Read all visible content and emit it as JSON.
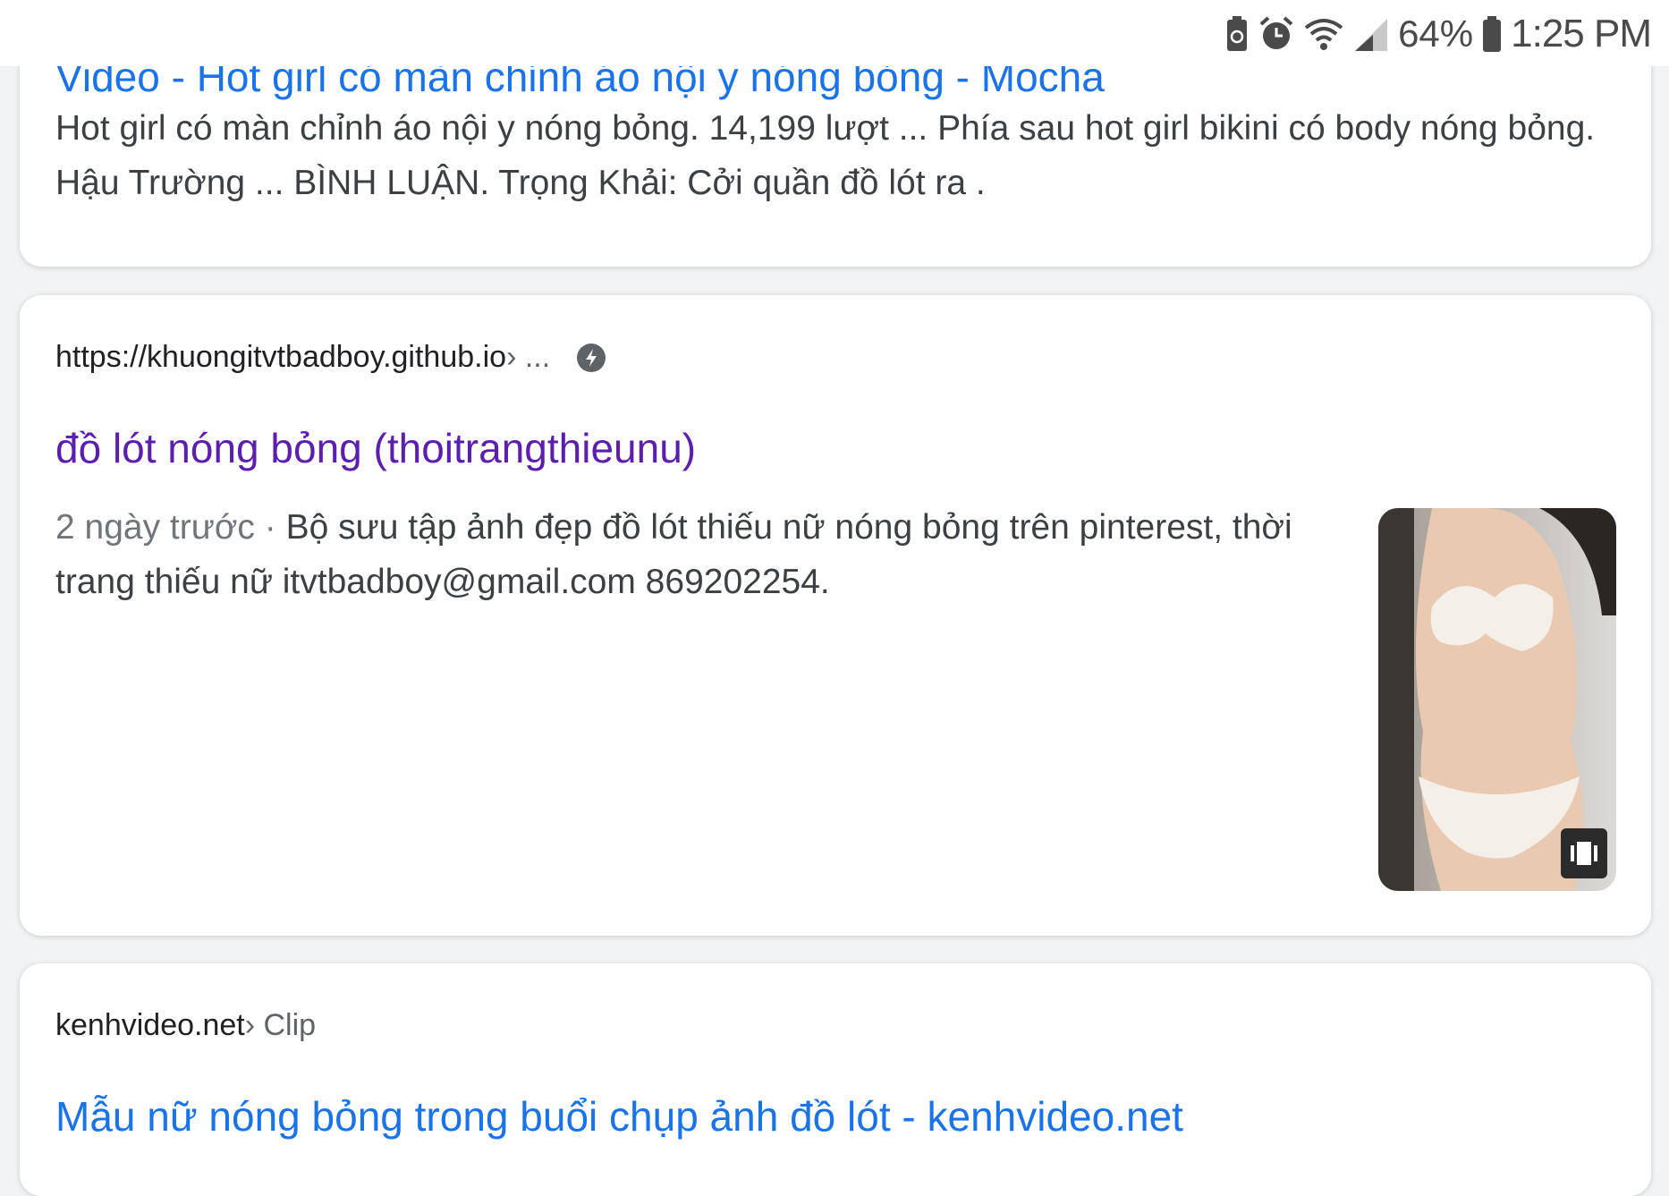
{
  "status_bar": {
    "icons": [
      "battery-saver-icon",
      "alarm-icon",
      "wifi-icon",
      "cell-signal-icon",
      "battery-icon"
    ],
    "battery_percent": "64%",
    "time": "1:25 PM"
  },
  "results": [
    {
      "title": "Video - Hot girl có màn chỉnh áo nội y nóng bỏng - Mocha",
      "snippet": "Hot girl có màn chỉnh áo nội y nóng bỏng. 14,199 lượt ... Phía sau hot girl bikini có body nóng bỏng. Hậu Trường ... BÌNH LUẬN. Trọng Khải: Cởi quần đồ lót ra ."
    },
    {
      "url": "https://khuongitvtbadboy.github.io",
      "url_crumb": " › ...",
      "amp_icon": "lightning-bolt-icon",
      "title": "đồ lót nóng bỏng (thoitrangthieunu)",
      "date": "2 ngày trước",
      "separator": " · ",
      "snippet": "Bộ sưu tập ảnh đẹp đồ lót thiếu nữ nóng bỏng trên pinterest, thời trang thiếu nữ itvtbadboy@gmail.com 869202254.",
      "thumbnail": {
        "badge_icon": "carousel-icon"
      }
    },
    {
      "url": "kenhvideo.net",
      "url_crumb": " › Clip",
      "title": "Mẫu nữ nóng bỏng trong buổi chụp ảnh đồ lót - kenhvideo.net"
    }
  ]
}
